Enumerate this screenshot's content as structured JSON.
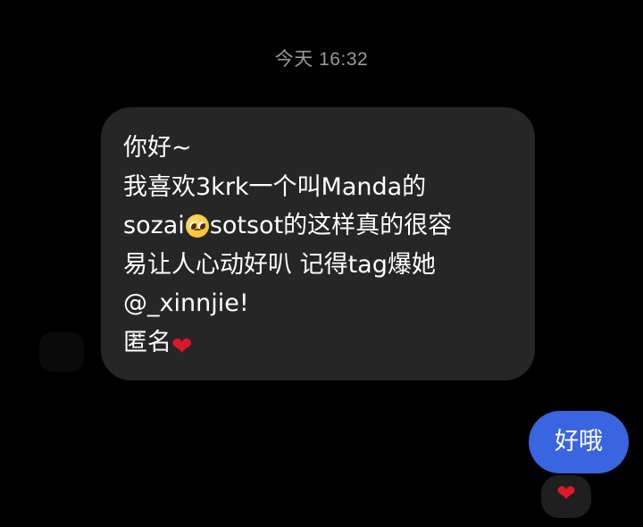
{
  "conversation": {
    "timestamp": "今天 16:32",
    "incoming_message": {
      "lines": [
        {
          "text": "你好~"
        },
        {
          "text": "我喜欢3krk一个叫Manda的"
        },
        {
          "before": "sozai",
          "emoji": "pleading-face",
          "after": "sotsot的这样真的很容"
        },
        {
          "text": "易让人心动好叭 记得tag爆她"
        },
        {
          "text": "@_xinnjie!"
        },
        {
          "before": "匿名",
          "emoji": "red-heart"
        }
      ]
    },
    "outgoing_message": {
      "text": "好哦",
      "reaction": "red-heart",
      "bubble_color": "#3a65e0"
    },
    "incoming_bubble_color": "#262626"
  }
}
